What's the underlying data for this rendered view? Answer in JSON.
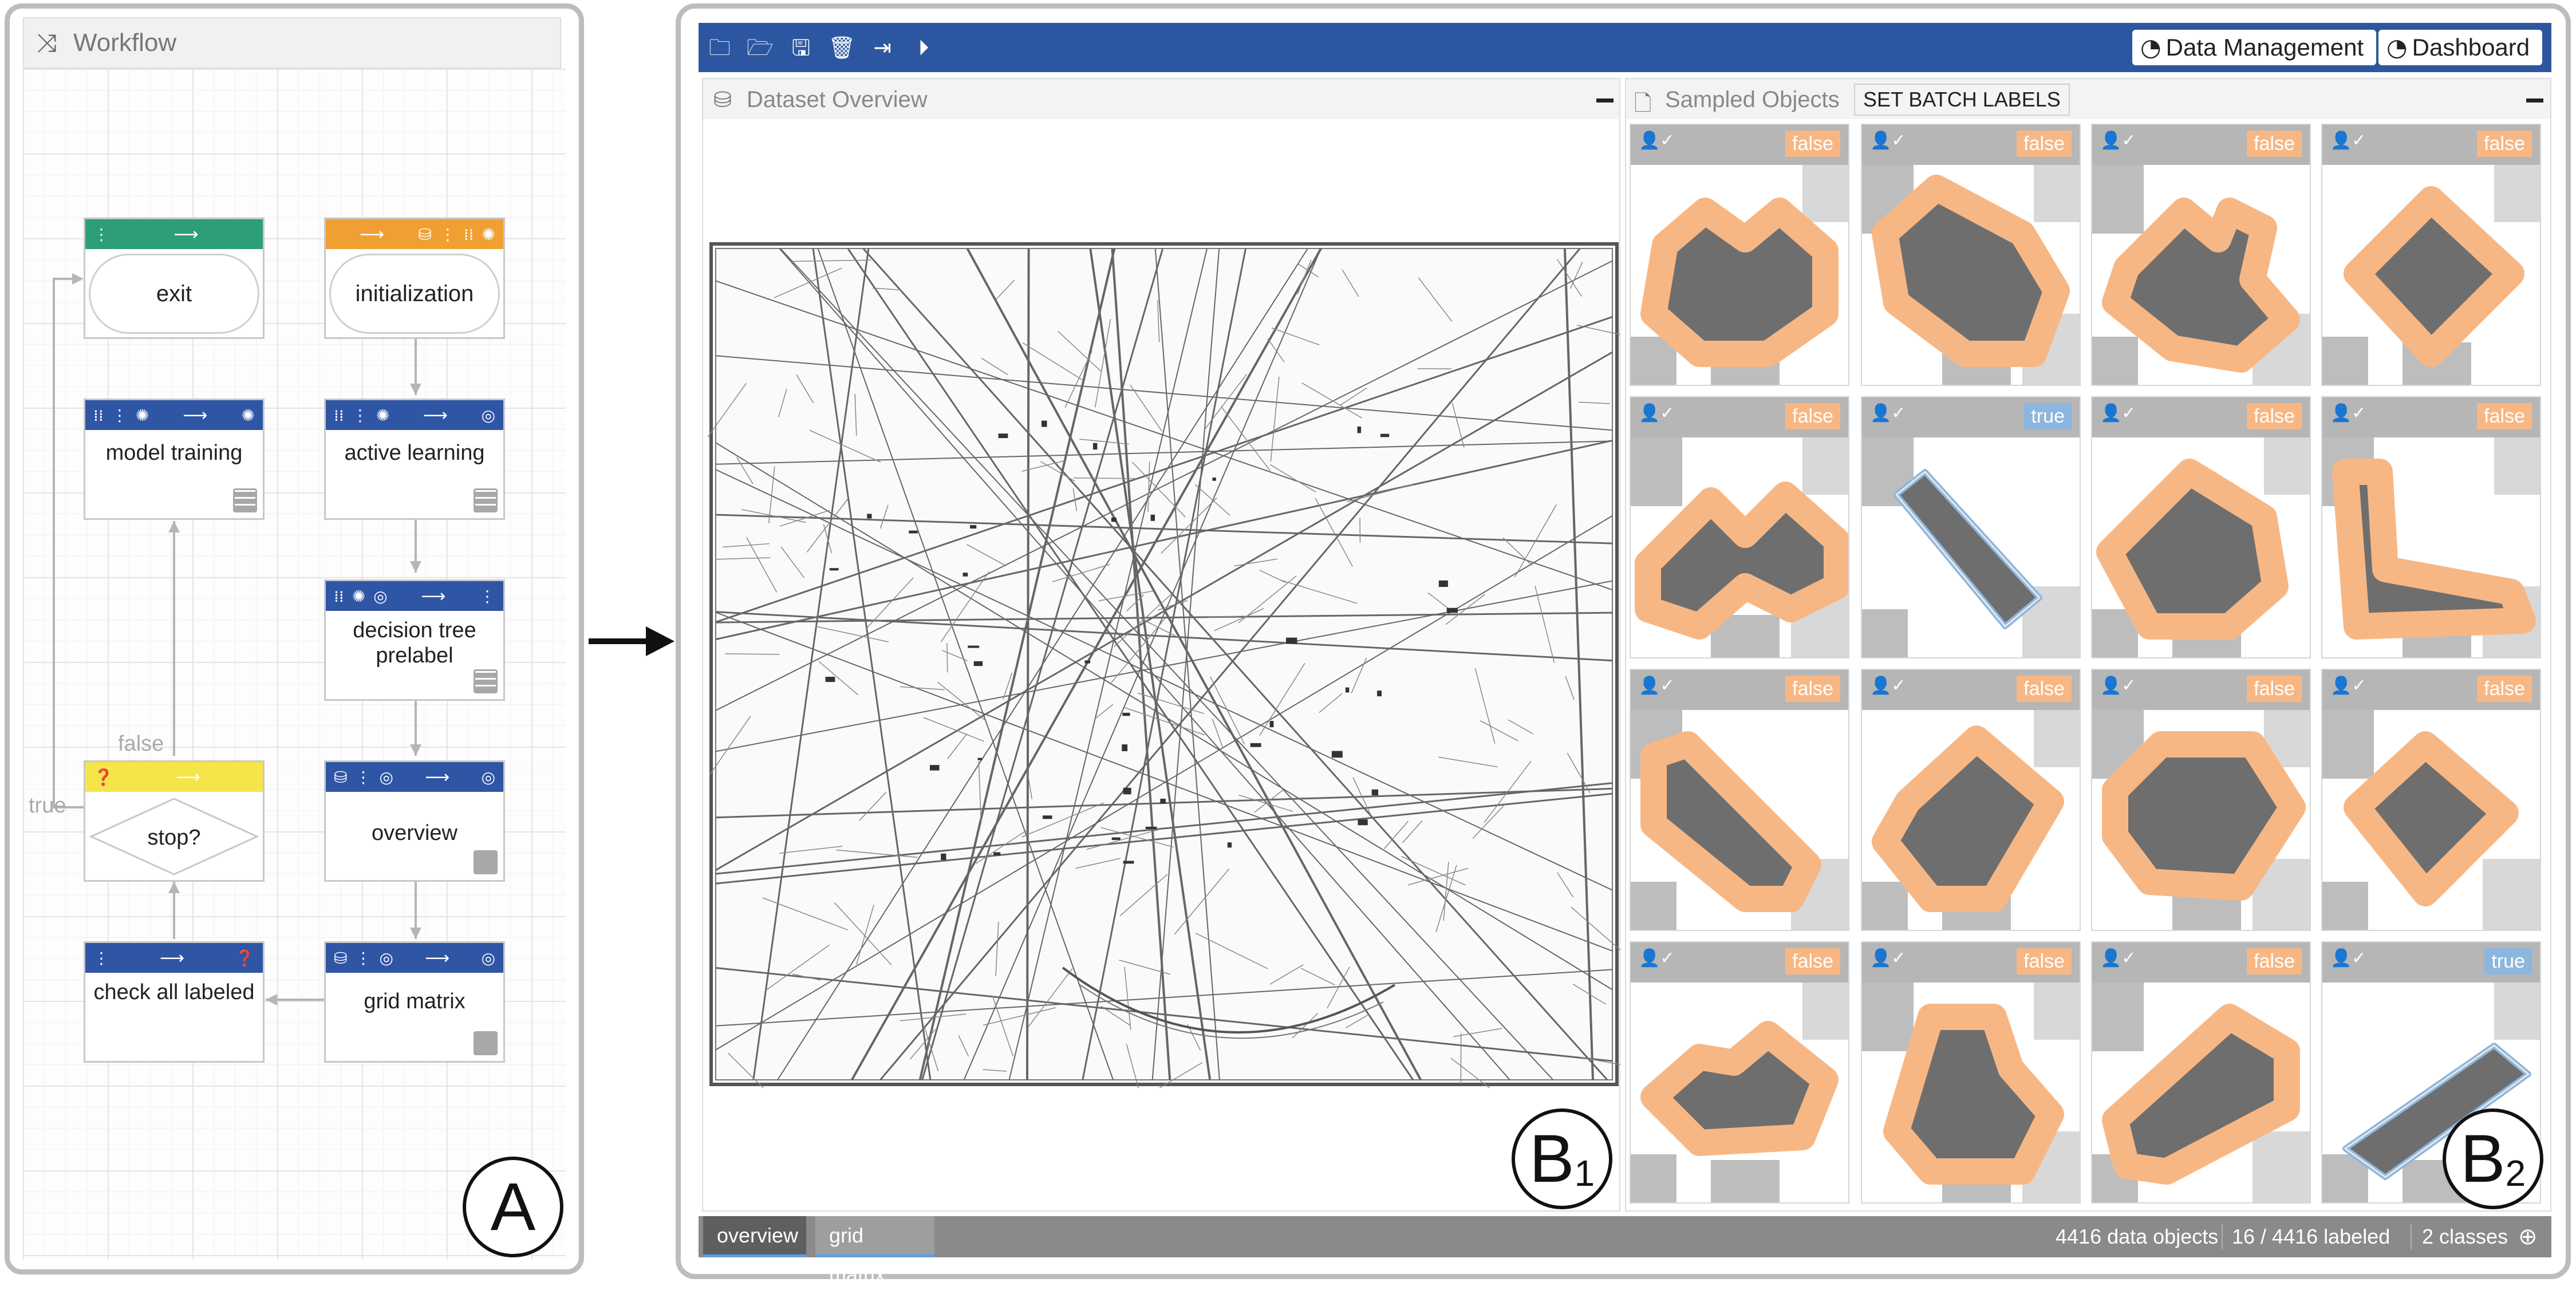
{
  "workflow": {
    "title": "Workflow",
    "nodes": {
      "exit": "exit",
      "initialization": "initialization",
      "model_training": "model training",
      "active_learning": "active learning",
      "decision_tree": "decision tree prelabel",
      "stop": "stop?",
      "overview": "overview",
      "check": "check all labeled",
      "grid": "grid matrix"
    },
    "edge_false": "false",
    "edge_true": "true"
  },
  "figure_labels": {
    "a": "A",
    "b1": "B",
    "b1_sub": "1",
    "b2": "B",
    "b2_sub": "2"
  },
  "toolbar": {
    "data_management": "Data Management",
    "dashboard": "Dashboard"
  },
  "dataset_overview": {
    "title": "Dataset Overview"
  },
  "sampled_objects": {
    "title": "Sampled Objects",
    "batch_button": "SET BATCH LABELS",
    "cards": [
      {
        "label": "false"
      },
      {
        "label": "false"
      },
      {
        "label": "false"
      },
      {
        "label": "false"
      },
      {
        "label": "false"
      },
      {
        "label": "true"
      },
      {
        "label": "false"
      },
      {
        "label": "false"
      },
      {
        "label": "false"
      },
      {
        "label": "false"
      },
      {
        "label": "false"
      },
      {
        "label": "false"
      },
      {
        "label": "false"
      },
      {
        "label": "false"
      },
      {
        "label": "false"
      },
      {
        "label": "true"
      }
    ]
  },
  "status": {
    "tabs": [
      "overview",
      "grid matrix"
    ],
    "objects": "4416 data objects",
    "labeled": "16 / 4416 labeled",
    "classes": "2 classes"
  },
  "colors": {
    "toolbar": "#2c57a0",
    "false_label": "#f7b784",
    "true_label": "#8cb6dd"
  }
}
